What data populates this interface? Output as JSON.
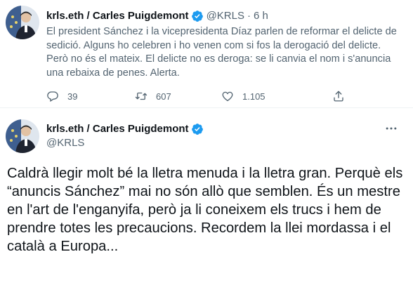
{
  "tweet1": {
    "display_name": "krls.eth / Carles Puigdemont",
    "handle": "@KRLS",
    "separator": "·",
    "time": "6 h",
    "text": "El president Sánchez i la vicepresidenta Díaz parlen de reformar el delicte de sedició. Alguns ho celebren i ho venen com si fos la derogació del delicte. Però no és el mateix. El delicte no es deroga: se li canvia el nom i s'anuncia una rebaixa de penes. Alerta.",
    "replies": "39",
    "retweets": "607",
    "likes": "1.105"
  },
  "tweet2": {
    "display_name": "krls.eth / Carles Puigdemont",
    "handle": "@KRLS",
    "text": "Caldrà llegir molt bé la lletra menuda i la lletra gran. Perquè els “anuncis Sánchez” mai no són allò que semblen. És un mestre en l'art de l'enganyifa, però ja li coneixem els trucs i hem de prendre totes les precaucions. Recordem la llei mordassa i el català a Europa..."
  },
  "colors": {
    "text_primary": "#0f1419",
    "text_secondary": "#536471",
    "verified_blue": "#1d9bf0",
    "divider": "#eff3f4"
  },
  "icons": {
    "reply": "speech-bubble-icon",
    "retweet": "retweet-arrows-icon",
    "like": "heart-icon",
    "share": "share-upload-icon",
    "more": "three-dots-icon",
    "verified": "verified-badge-icon"
  }
}
